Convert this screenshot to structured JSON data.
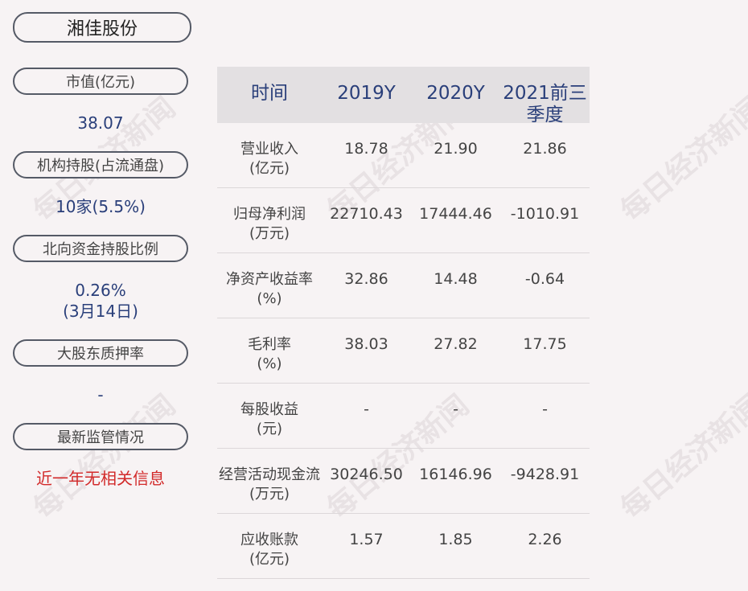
{
  "stock_name": "湘佳股份",
  "left": {
    "market_cap": {
      "label": "市值(亿元)",
      "value": "38.07"
    },
    "institutional": {
      "label": "机构持股(占流通盘)",
      "value": "10家(5.5%)"
    },
    "northbound": {
      "label": "北向资金持股比例",
      "value": "0.26%",
      "date": "(3月14日)"
    },
    "pledge": {
      "label": "大股东质押率",
      "value": "-"
    },
    "regulation": {
      "label": "最新监管情况",
      "value": "近一年无相关信息"
    }
  },
  "table": {
    "headers": [
      "时间",
      "2019Y",
      "2020Y",
      "2021前三季度"
    ],
    "rows": [
      {
        "label": "营业收入",
        "unit": "(亿元)",
        "values": [
          "18.78",
          "21.90",
          "21.86"
        ]
      },
      {
        "label": "归母净利润",
        "unit": "(万元)",
        "values": [
          "22710.43",
          "17444.46",
          "-1010.91"
        ]
      },
      {
        "label": "净资产收益率",
        "unit": "(%)",
        "values": [
          "32.86",
          "14.48",
          "-0.64"
        ]
      },
      {
        "label": "毛利率",
        "unit": "(%)",
        "values": [
          "38.03",
          "27.82",
          "17.75"
        ]
      },
      {
        "label": "每股收益",
        "unit": "(元)",
        "values": [
          "-",
          "-",
          "-"
        ]
      },
      {
        "label": "经营活动现金流",
        "unit": "(万元)",
        "values": [
          "30246.50",
          "16146.96",
          "-9428.91"
        ]
      },
      {
        "label": "应收账款",
        "unit": "(亿元)",
        "values": [
          "1.57",
          "1.85",
          "2.26"
        ]
      }
    ]
  },
  "watermark": "每日经济新闻"
}
